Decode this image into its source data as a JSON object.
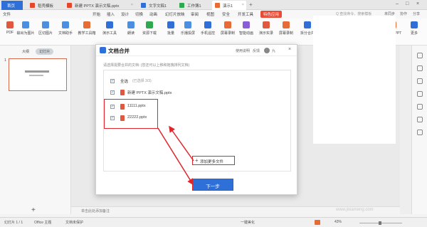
{
  "tabs": {
    "home": "首页",
    "items": [
      {
        "label": "稻壳模板",
        "color": "#e8452a"
      },
      {
        "label": "新建 PPTX 演示文稿.pptx",
        "color": "#e8452a"
      },
      {
        "label": "文字文稿1",
        "color": "#2f6fd8"
      },
      {
        "label": "工作簿1",
        "color": "#2fa84f"
      },
      {
        "label": "演示1",
        "color": "#e86b36"
      }
    ]
  },
  "menu": {
    "file": "文件",
    "items": [
      "开始",
      "插入",
      "设计",
      "切换",
      "动画",
      "幻灯片放映",
      "审阅",
      "视图",
      "安全",
      "开发工具",
      "特色应用"
    ],
    "highlight": "特色应用",
    "search": "Q 查找命令、搜索模板",
    "sync": "未同步",
    "collab": "协作",
    "share": "分享"
  },
  "toolbar": {
    "tools": [
      {
        "label": "PDF",
        "color": "#e2583e"
      },
      {
        "label": "输出为图片",
        "color": "#4a8fe0"
      },
      {
        "label": "区切图片",
        "color": "#4a8fe0"
      },
      {
        "label": "文档助手",
        "color": "#4a8fe0"
      },
      {
        "label": "教学工具箱",
        "color": "#e86b36"
      },
      {
        "label": "演示工具",
        "color": "#2f6fd8"
      },
      {
        "label": "朗读",
        "color": "#4a8fe0"
      },
      {
        "label": "资源下载",
        "color": "#2fa84f"
      },
      {
        "label": "批量",
        "color": "#2f6fd8"
      },
      {
        "label": "乐播投屏",
        "color": "#4a8fe0"
      },
      {
        "label": "手机遥控",
        "color": "#2f6fd8"
      },
      {
        "label": "屏幕录制",
        "color": "#e86b36"
      },
      {
        "label": "智能动画",
        "color": "#8a5cd8"
      },
      {
        "label": "演示实录",
        "color": "#e2583e"
      },
      {
        "label": "屏幕录制",
        "color": "#e86b36"
      },
      {
        "label": "拆分合并",
        "color": "#2f6fd8"
      },
      {
        "label": "截图取字",
        "color": "#4a8fe0"
      },
      {
        "label": "全文翻译",
        "color": "#2f6fd8"
      },
      {
        "label": "图片转PDF",
        "color": "#e2583e"
      },
      {
        "label": "图片转PPT",
        "color": "#e86b36"
      },
      {
        "label": "更多",
        "color": "#2f6fd8"
      }
    ]
  },
  "left_panel": {
    "tab_outline": "大纲",
    "tab_slides": "幻灯片",
    "slide_number": "1"
  },
  "notes": {
    "placeholder": "单击此处添加备注"
  },
  "dialog": {
    "title": "文档合并",
    "help": "使用说明",
    "feedback": "反馈",
    "user": "九",
    "hint": "请选择需要合并的文档: (您还可以上移和拖拽排列文档)",
    "select_all": "全选",
    "selected_count": "(已选择 3/3)",
    "files": [
      {
        "name": "新建 PPTX 演示文稿.pptx",
        "checked": true
      },
      {
        "name": "11111.pptx",
        "checked": true
      },
      {
        "name": "22222.pptx",
        "checked": true
      }
    ],
    "add_more": "添加更多文件",
    "next": "下一步"
  },
  "status": {
    "slide_info": "幻灯片 1 / 1",
    "theme": "Office 主题",
    "doc_state": "文档未保护",
    "beautify": "一键美化",
    "zoom": "43%",
    "watermark": "www.jixiameng.com"
  },
  "colors": {
    "accent": "#2f6fd8",
    "highlight_red": "#e0262b",
    "ppt_orange": "#e86b36"
  }
}
